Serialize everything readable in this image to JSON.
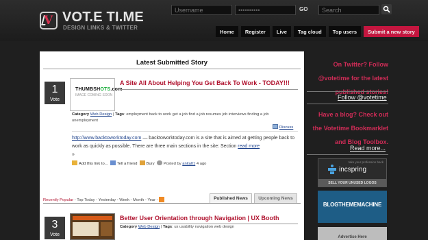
{
  "header": {
    "brand": "VOT.E TI.ME",
    "tagline": "DESIGN LINKS & TWITTER",
    "username_placeholder": "Username",
    "password_value": "••••••••••",
    "go_label": "GO",
    "search_placeholder": "Search"
  },
  "nav": [
    {
      "label": "Home"
    },
    {
      "label": "Register"
    },
    {
      "label": "Live"
    },
    {
      "label": "Tag cloud"
    },
    {
      "label": "Top users"
    },
    {
      "label": "Submit a new story"
    }
  ],
  "main": {
    "title": "Latest Submitted Story",
    "story1": {
      "votes": "1",
      "vote_label": "Vote",
      "thumb_brand_a": "THUMBSH",
      "thumb_brand_b": "OTS",
      "thumb_brand_c": ".com",
      "thumb_sub": "IMAGE COMING SOON",
      "title": "A Site All About Helping You Get Back To Work - TODAY!!!",
      "category_label": "Category",
      "category": "Web Design",
      "tags_label": "Tags",
      "tags": "employment back to work get a job find a job resumes job interviews finding a job unemployment",
      "discuss": "Discuss",
      "url": "http://www.backtoworktoday.com",
      "description": " — backtoworktoday.com is a site that is aimed at getting people back to work as quickly as possible. There are three main sections in the site: Section",
      "read_more": "read more",
      "read_more_suffix": "»",
      "actions": {
        "add_link": "Add this link to...",
        "tell_friend": "Tell a friend",
        "bury": "Bury",
        "posted_by_label": "Posted by",
        "author": "anita01",
        "time": "4 ago"
      }
    },
    "filters": {
      "recently_popular": "Recently Popular",
      "text": "- Top Today - Yesterday - Week - Month - Year -"
    },
    "tabs": {
      "published": "Published News",
      "upcoming": "Upcoming News"
    },
    "story2": {
      "votes": "3",
      "vote_label": "Vote",
      "title": "Better User Orientation through Navigation | UX Booth",
      "category_label": "Category",
      "category": "Web Design",
      "tags_label": "Tags",
      "tags": "ux usability navigation web design"
    }
  },
  "sidebar": {
    "twitter_line1": "On Twitter? Follow",
    "twitter_line2": "@votetime for the latest",
    "twitter_line3": "published stories!",
    "follow_link": "Follow @votetime",
    "blog_line1": "Have a blog? Check out",
    "blog_line2": "the Votetime Bookmarklet",
    "blog_line3": "and Blog Toolbox.",
    "read_more": "Read more...",
    "ad1_tag": "take your profession back",
    "ad1_brand": "incspring",
    "ad1_cta": "SELL YOUR UNUSED LOGOS",
    "ad2_brand": "BLOGTHEMEMACHINE",
    "ad3_text": "Advertise Here"
  },
  "colors": {
    "accent": "#c4163f",
    "story_title": "#b0132f",
    "sidebar_pink": "#d02c57"
  }
}
